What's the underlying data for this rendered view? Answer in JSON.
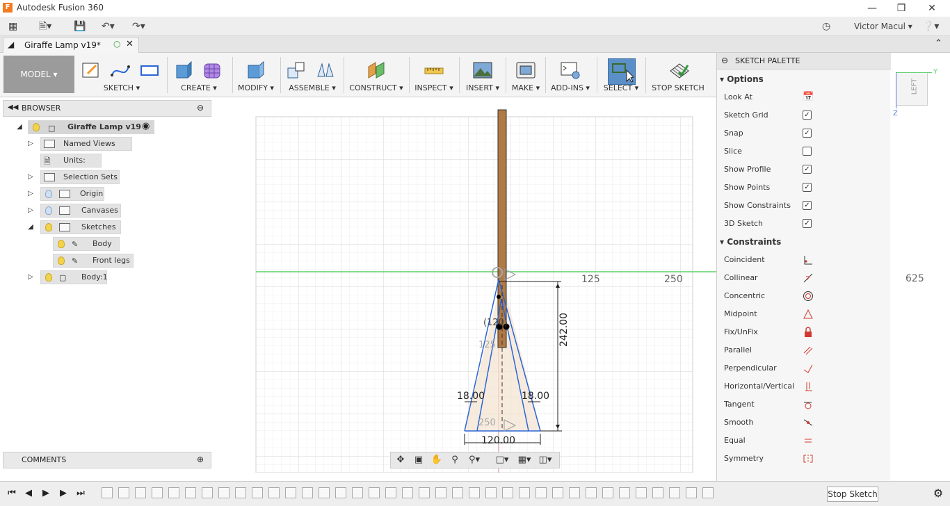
{
  "app": {
    "title": "Autodesk Fusion 360",
    "logo": "F",
    "user": "Victor Macul"
  },
  "document_tab": {
    "title": "Giraffe Lamp v19*"
  },
  "ribbon": {
    "model_label": "MODEL",
    "groups": [
      {
        "label": "SKETCH"
      },
      {
        "label": "CREATE"
      },
      {
        "label": "MODIFY"
      },
      {
        "label": "ASSEMBLE"
      },
      {
        "label": "CONSTRUCT"
      },
      {
        "label": "INSPECT"
      },
      {
        "label": "INSERT"
      },
      {
        "label": "MAKE"
      },
      {
        "label": "ADD-INS"
      },
      {
        "label": "SELECT"
      },
      {
        "label": "STOP SKETCH"
      }
    ]
  },
  "browser": {
    "title": "BROWSER",
    "root": "Giraffe Lamp v19",
    "items": [
      {
        "label": "Named Views"
      },
      {
        "label": "Units: mm"
      },
      {
        "label": "Selection Sets"
      },
      {
        "label": "Origin"
      },
      {
        "label": "Canvases"
      },
      {
        "label": "Sketches"
      },
      {
        "label": "Body"
      },
      {
        "label": "Front legs"
      },
      {
        "label": "Body:1"
      }
    ]
  },
  "comments": {
    "title": "COMMENTS"
  },
  "viewport": {
    "axis_labels": [
      "125",
      "250",
      "625"
    ],
    "dimensions": [
      "242.00",
      "18.00",
      "18.00",
      "120.00",
      "125",
      "250",
      "(120)"
    ],
    "viewcube_face": "LEFT",
    "axis_y": "Y",
    "axis_z": "Z",
    "colors": {
      "sketch_line": "#2a66d6",
      "body": "#b07a45",
      "ground": "#5ad06a"
    }
  },
  "palette": {
    "title": "SKETCH PALETTE",
    "options_title": "Options",
    "options": [
      {
        "label": "Look At",
        "type": "button",
        "icon": "look-at-icon"
      },
      {
        "label": "Sketch Grid",
        "checked": true
      },
      {
        "label": "Snap",
        "checked": true
      },
      {
        "label": "Slice",
        "checked": false
      },
      {
        "label": "Show Profile",
        "checked": true
      },
      {
        "label": "Show Points",
        "checked": true
      },
      {
        "label": "Show Constraints",
        "checked": true
      },
      {
        "label": "3D Sketch",
        "checked": true
      }
    ],
    "constraints_title": "Constraints",
    "constraints": [
      {
        "label": "Coincident",
        "icon": "coincident-icon"
      },
      {
        "label": "Collinear",
        "icon": "collinear-icon"
      },
      {
        "label": "Concentric",
        "icon": "concentric-icon"
      },
      {
        "label": "Midpoint",
        "icon": "midpoint-icon"
      },
      {
        "label": "Fix/UnFix",
        "icon": "lock-icon"
      },
      {
        "label": "Parallel",
        "icon": "parallel-icon"
      },
      {
        "label": "Perpendicular",
        "icon": "perpendicular-icon"
      },
      {
        "label": "Horizontal/Vertical",
        "icon": "horizontal-vertical-icon"
      },
      {
        "label": "Tangent",
        "icon": "tangent-icon"
      },
      {
        "label": "Smooth",
        "icon": "smooth-icon"
      },
      {
        "label": "Equal",
        "icon": "equal-icon"
      },
      {
        "label": "Symmetry",
        "icon": "symmetry-icon"
      }
    ],
    "stop_sketch": "Stop Sketch"
  }
}
